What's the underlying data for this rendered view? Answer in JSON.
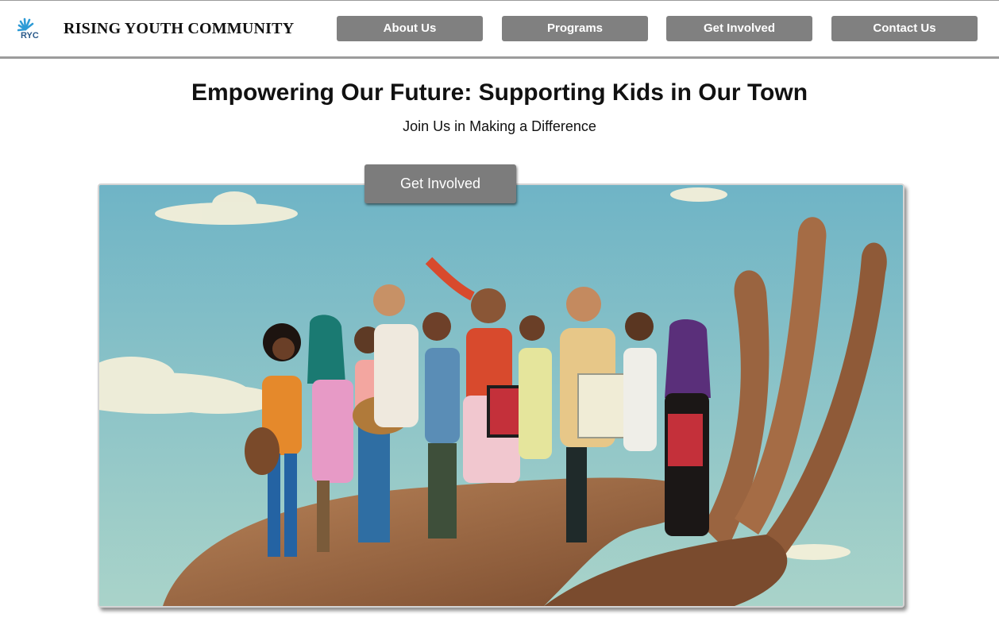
{
  "header": {
    "logo_text": "RYC",
    "brand_name": "RISING YOUTH COMMUNITY",
    "nav": [
      {
        "label": "About Us"
      },
      {
        "label": "Programs"
      },
      {
        "label": "Get Involved"
      },
      {
        "label": "Contact Us"
      }
    ]
  },
  "hero": {
    "title": "Empowering Our Future: Supporting Kids in Our Town",
    "subtitle": "Join Us in Making a Difference",
    "cta_label": "Get Involved"
  },
  "colors": {
    "nav_button_bg": "#808080",
    "cta_bg": "#7c7c7c",
    "logo_blue": "#2e9bd6",
    "sky": "#8fc3c9"
  }
}
